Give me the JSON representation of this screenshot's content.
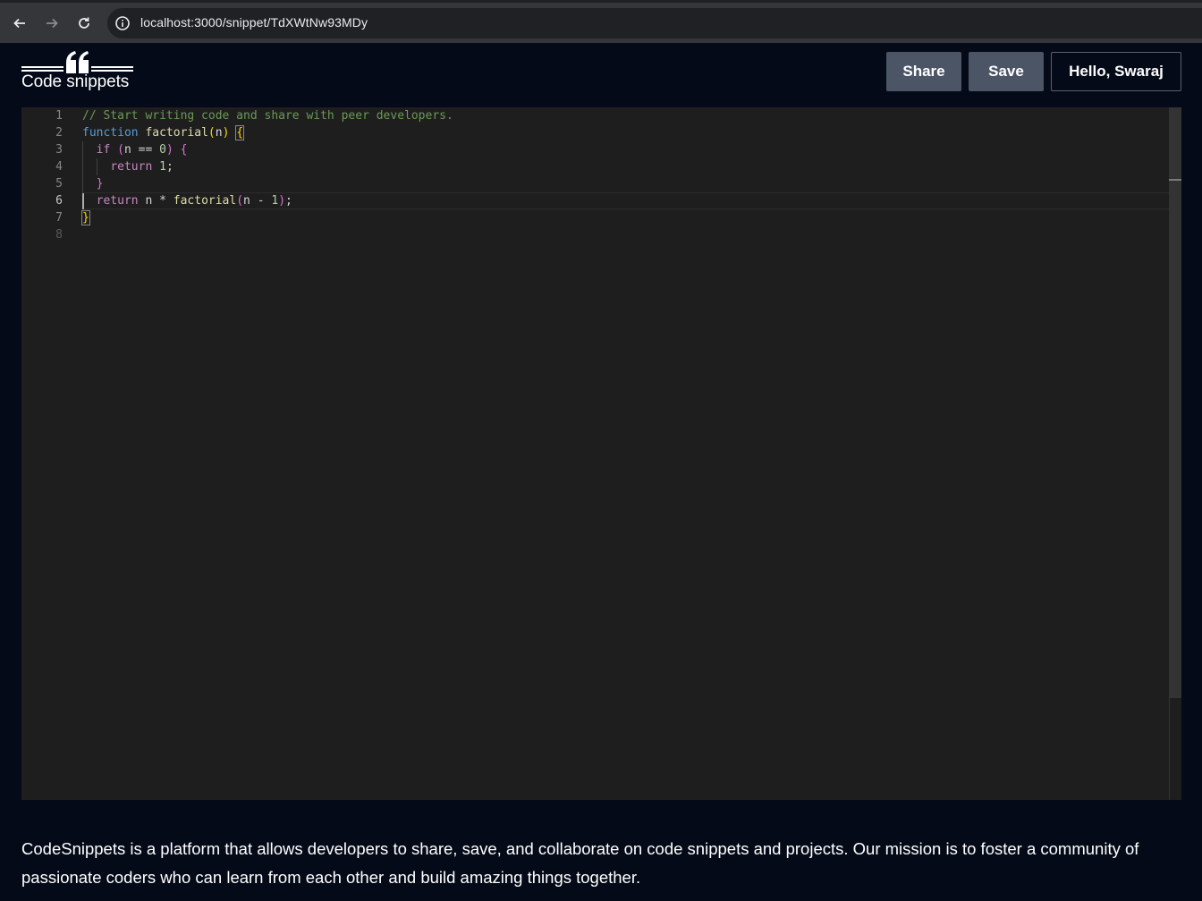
{
  "browser": {
    "url": "localhost:3000/snippet/TdXWtNw93MDy",
    "back_icon": "arrow-left-icon",
    "forward_icon": "arrow-right-icon",
    "reload_icon": "reload-icon",
    "info_icon": "info-icon"
  },
  "header": {
    "logo_text": "Code snippets",
    "share_label": "Share",
    "save_label": "Save",
    "user_label": "Hello, Swaraj"
  },
  "editor": {
    "line_numbers": [
      "1",
      "2",
      "3",
      "4",
      "5",
      "6",
      "7",
      "8"
    ],
    "active_line": 6,
    "lines": [
      "// Start writing code and share with peer developers.",
      "function factorial(n) {",
      "  if (n == 0) {",
      "    return 1;",
      "  }",
      "  return n * factorial(n - 1);",
      "}",
      ""
    ]
  },
  "footer": {
    "about": "CodeSnippets is a platform that allows developers to share, save, and collaborate on code snippets and projects. Our mission is to foster a community of passionate coders who can learn from each other and build amazing things together."
  },
  "colors": {
    "page_bg": "#050a18",
    "editor_bg": "#1e1e1e",
    "button_bg": "#4b5565"
  }
}
